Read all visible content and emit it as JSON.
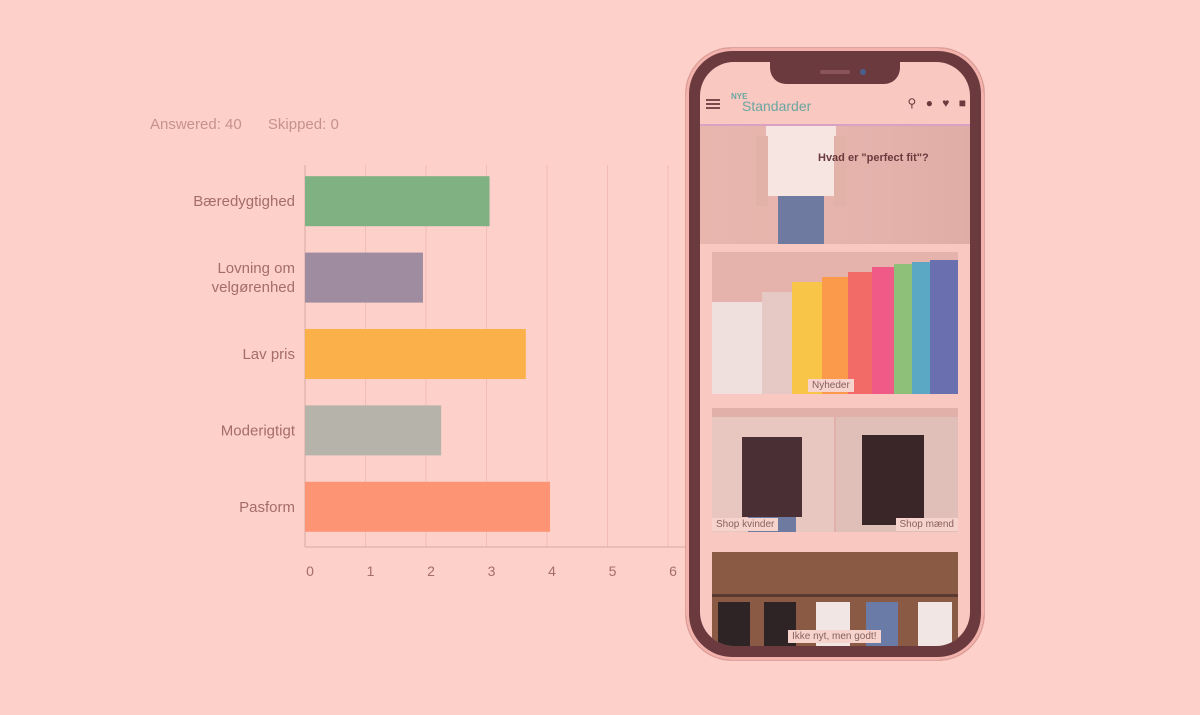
{
  "stats": {
    "answered": "Answered: 40",
    "skipped": "Skipped: 0"
  },
  "colors": {
    "background": "#fdd0c9",
    "grid": "#f3bdb7",
    "axis": "#d8aaa4",
    "label": "#a56d68"
  },
  "chart_data": {
    "type": "bar",
    "orientation": "horizontal",
    "categories": [
      "Bæredygtighed",
      "Lovning om velgørenhed",
      "Lav pris",
      "Moderigtigt",
      "Pasform"
    ],
    "category_lines": [
      [
        "Bæredygtighed"
      ],
      [
        "Lovning om",
        "velgørenhed"
      ],
      [
        "Lav pris"
      ],
      [
        "Moderigtigt"
      ],
      [
        "Pasform"
      ]
    ],
    "values": [
      3.05,
      1.95,
      3.65,
      2.25,
      4.05
    ],
    "bar_colors": [
      "#7fb183",
      "#a08ca0",
      "#fbb04a",
      "#b6b3ab",
      "#fd9574"
    ],
    "xticks": [
      "0",
      "1",
      "2",
      "3",
      "4",
      "5",
      "6"
    ],
    "xlim": [
      0,
      6
    ],
    "grid": true,
    "title": "",
    "xlabel": "",
    "ylabel": ""
  },
  "phone": {
    "brand_small": "NYE",
    "brand": "Standarder",
    "hero_title": "Hvad er \"perfect fit\"?",
    "tiles": {
      "news": "Nyheder",
      "women": "Shop kvinder",
      "men": "Shop mænd",
      "classic": "Ikke nyt, men godt!"
    },
    "icons": [
      "menu-icon",
      "search-icon",
      "user-icon",
      "heart-icon",
      "bag-icon"
    ]
  }
}
